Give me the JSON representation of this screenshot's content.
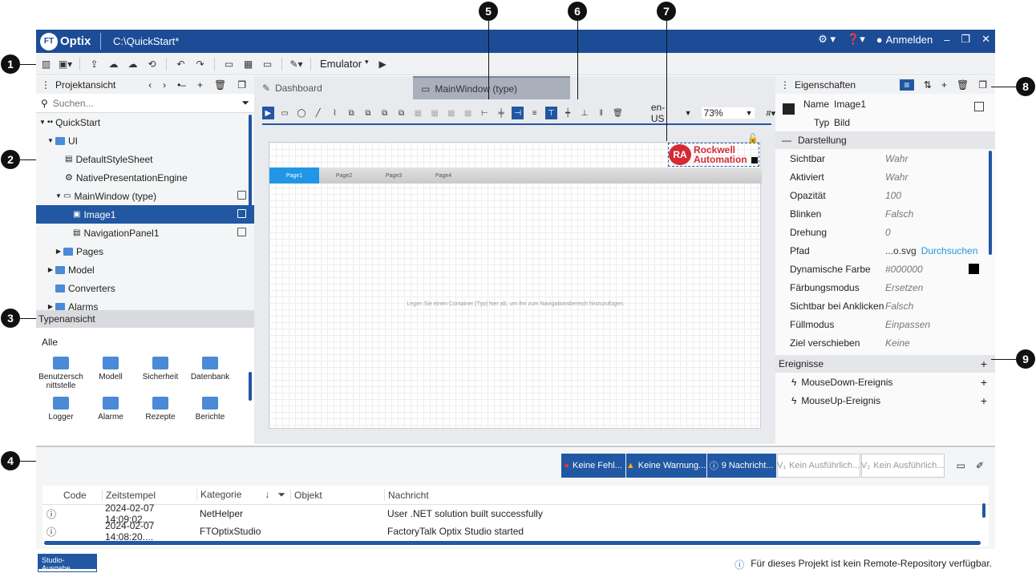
{
  "titlebar": {
    "logo_text": "Optix",
    "logo_badge": "FT",
    "title": "C:\\QuickStart*",
    "login_label": "Anmelden"
  },
  "toolbar": {
    "emulator_label": "Emulator"
  },
  "project_panel": {
    "title": "Projektansicht",
    "search_placeholder": "Suchen...",
    "tree": [
      {
        "label": "QuickStart"
      },
      {
        "label": "UI"
      },
      {
        "label": "DefaultStyleSheet"
      },
      {
        "label": "NativePresentationEngine"
      },
      {
        "label": "MainWindow (type)"
      },
      {
        "label": "Image1"
      },
      {
        "label": "NavigationPanel1"
      },
      {
        "label": "Pages"
      },
      {
        "label": "Model"
      },
      {
        "label": "Converters"
      },
      {
        "label": "Alarms"
      }
    ]
  },
  "type_panel": {
    "title": "Typenansicht",
    "filter": "Alle",
    "items": [
      {
        "label": "Benutzersch nittstelle"
      },
      {
        "label": "Modell"
      },
      {
        "label": "Sicherheit"
      },
      {
        "label": "Datenbank"
      },
      {
        "label": "Logger"
      },
      {
        "label": "Alarme"
      },
      {
        "label": "Rezepte"
      },
      {
        "label": "Berichte"
      }
    ]
  },
  "editor": {
    "tabs": [
      {
        "label": "Dashboard"
      },
      {
        "label": "MainWindow (type)"
      }
    ],
    "locale": "en-US",
    "zoom": "73%",
    "nav_tabs": [
      "Page1",
      "Page2",
      "Page3",
      "Page4"
    ],
    "hint": "Legen Sie einen Container (Typ) hier ab, um ihn zum Navigationsbereich hinzuzufügen.",
    "logo_badge": "RA",
    "logo_line1": "Rockwell",
    "logo_line2": "Automation"
  },
  "properties": {
    "title": "Eigenschaften",
    "name_label": "Name",
    "name_value": "Image1",
    "type_label": "Typ",
    "type_value": "Bild",
    "section_appearance": "Darstellung",
    "rows": [
      {
        "key": "Sichtbar",
        "value": "Wahr"
      },
      {
        "key": "Aktiviert",
        "value": "Wahr"
      },
      {
        "key": "Opazität",
        "value": "100"
      },
      {
        "key": "Blinken",
        "value": "Falsch"
      },
      {
        "key": "Drehung",
        "value": "0"
      },
      {
        "key": "Pfad",
        "value": "...o.svg"
      },
      {
        "key": "Dynamische Farbe",
        "value": "#000000"
      },
      {
        "key": "Färbungsmodus",
        "value": "Ersetzen"
      },
      {
        "key": "Sichtbar bei Anklicken",
        "value": "Falsch"
      },
      {
        "key": "Füllmodus",
        "value": "Einpassen"
      },
      {
        "key": "Ziel verschieben",
        "value": "Keine"
      }
    ],
    "browse_label": "Durchsuchen",
    "section_events": "Ereignisse",
    "events": [
      {
        "label": "MouseDown-Ereignis"
      },
      {
        "label": "MouseUp-Ereignis"
      }
    ]
  },
  "output": {
    "filters": [
      {
        "label": "Keine Fehl..."
      },
      {
        "label": "Keine Warnung..."
      },
      {
        "label": "9 Nachricht..."
      },
      {
        "label": "Kein Ausführlich..."
      },
      {
        "label": "Kein Ausführlich..."
      }
    ],
    "columns": [
      "Code",
      "Zeitstempel",
      "Kategorie",
      "Objekt",
      "Nachricht"
    ],
    "rows": [
      {
        "timestamp": "2024-02-07 14:09:02....",
        "category": "NetHelper",
        "object": "",
        "message": "User .NET solution built successfully"
      },
      {
        "timestamp": "2024-02-07 14:08:20....",
        "category": "FTOptixStudio",
        "object": "",
        "message": "FactoryTalk Optix Studio started"
      }
    ],
    "tab_label": "Studio-Ausgabe",
    "status_message": "Für dieses Projekt ist kein Remote-Repository verfügbar."
  },
  "callouts": [
    "1",
    "2",
    "3",
    "4",
    "5",
    "6",
    "7",
    "8",
    "9"
  ],
  "colors": {
    "titlebar": "#1c4c96",
    "selection": "#2157a3",
    "accent": "#2196e6",
    "ra_red": "#d42a36"
  }
}
